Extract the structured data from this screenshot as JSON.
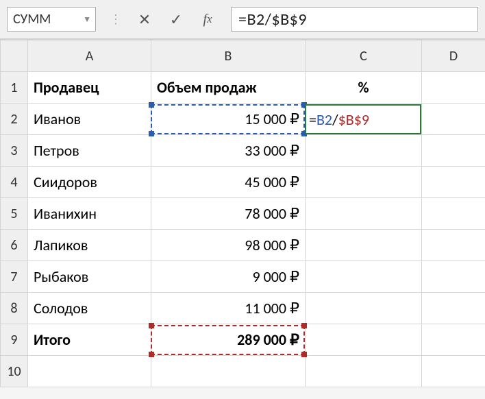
{
  "nameBox": "СУММ",
  "formula": "=B2/$B$9",
  "columns": [
    "A",
    "B",
    "C",
    "D"
  ],
  "headers": {
    "seller": "Продавец",
    "volume": "Объем продаж",
    "percent": "%"
  },
  "rows": [
    {
      "n": "1"
    },
    {
      "n": "2",
      "a": "Иванов",
      "b": "15 000 ₽"
    },
    {
      "n": "3",
      "a": "Петров",
      "b": "33 000 ₽"
    },
    {
      "n": "4",
      "a": "Сиидоров",
      "b": "45 000 ₽"
    },
    {
      "n": "5",
      "a": "Иванихин",
      "b": "78 000 ₽"
    },
    {
      "n": "6",
      "a": "Лапиков",
      "b": "98 000 ₽"
    },
    {
      "n": "7",
      "a": "Рыбаков",
      "b": "9 000 ₽"
    },
    {
      "n": "8",
      "a": "Солодов",
      "b": "11 000 ₽"
    },
    {
      "n": "9",
      "a": "Итого",
      "b": "289 000 ₽"
    },
    {
      "n": "10"
    }
  ],
  "editCell": {
    "eq": "=",
    "ref1": "B2",
    "slash": "/",
    "ref2": "$B$9"
  }
}
